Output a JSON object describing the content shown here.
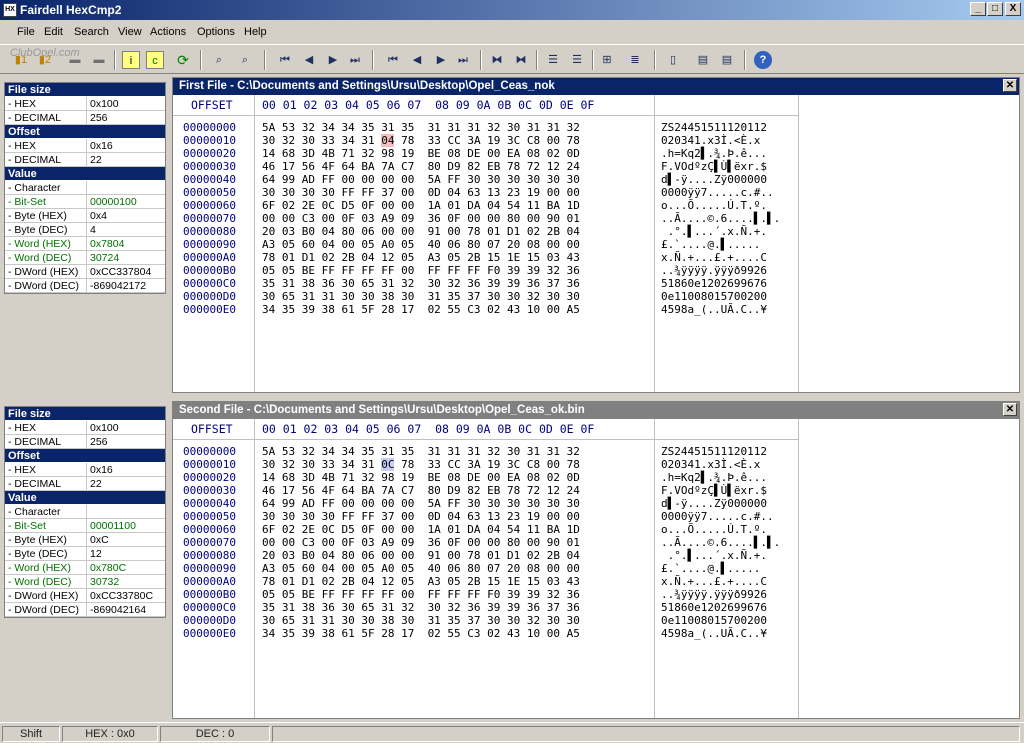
{
  "app": {
    "title": "Fairdell HexCmp2"
  },
  "window_controls": {
    "minimize": "_",
    "maximize": "□",
    "close": "X"
  },
  "menu": [
    "File",
    "Edit",
    "Search",
    "View",
    "Actions",
    "Options",
    "Help"
  ],
  "watermark": "ClubOpel.com",
  "toolbar_icons": [
    "open-file-1-icon",
    "open-file-2-icon",
    "save-icon",
    "print-icon",
    "info-icon",
    "compare-icon",
    "refresh-icon",
    "find-icon",
    "find-next-icon",
    "first-diff-icon",
    "prev-diff-icon",
    "next-diff-icon",
    "last-diff-icon",
    "first-block-icon",
    "prev-block-icon",
    "next-block-icon",
    "last-block-icon",
    "sync-left-icon",
    "sync-right-icon",
    "align-up-icon",
    "align-down-icon",
    "column-icon",
    "lines-icon",
    "new-doc-icon",
    "report-icon",
    "export-icon",
    "help-icon"
  ],
  "colors": {
    "title_active": "#0a246a",
    "title_inactive": "#808080",
    "diff_first": "#f4c0c0",
    "cursor": "#c6cff4",
    "green_value": "#007000",
    "offset_blue": "#000080"
  },
  "info_top": {
    "rows": [
      {
        "type": "hdr",
        "label": "File size"
      },
      {
        "label": "- HEX",
        "value": "0x100"
      },
      {
        "label": "- DECIMAL",
        "value": "256"
      },
      {
        "type": "hdr",
        "label": "Offset"
      },
      {
        "label": "- HEX",
        "value": "0x16"
      },
      {
        "label": "- DECIMAL",
        "value": "22"
      },
      {
        "type": "hdr",
        "label": "Value"
      },
      {
        "label": "- Character",
        "value": ""
      },
      {
        "label": "- Bit-Set",
        "value": "00000100",
        "green": true
      },
      {
        "label": "- Byte (HEX)",
        "value": "0x4"
      },
      {
        "label": "- Byte (DEC)",
        "value": "4"
      },
      {
        "label": "- Word (HEX)",
        "value": "0x7804",
        "green": true
      },
      {
        "label": "- Word (DEC)",
        "value": "30724",
        "green": true
      },
      {
        "label": "- DWord (HEX)",
        "value": "0xCC337804"
      },
      {
        "label": "- DWord (DEC)",
        "value": "-869042172"
      }
    ]
  },
  "info_bottom": {
    "rows": [
      {
        "type": "hdr",
        "label": "File size"
      },
      {
        "label": "- HEX",
        "value": "0x100"
      },
      {
        "label": "- DECIMAL",
        "value": "256"
      },
      {
        "type": "hdr",
        "label": "Offset"
      },
      {
        "label": "- HEX",
        "value": "0x16"
      },
      {
        "label": "- DECIMAL",
        "value": "22"
      },
      {
        "type": "hdr",
        "label": "Value"
      },
      {
        "label": "- Character",
        "value": ""
      },
      {
        "label": "- Bit-Set",
        "value": "00001100",
        "green": true
      },
      {
        "label": "- Byte (HEX)",
        "value": "0xC"
      },
      {
        "label": "- Byte (DEC)",
        "value": "12"
      },
      {
        "label": "- Word (HEX)",
        "value": "0x780C",
        "green": true
      },
      {
        "label": "- Word (DEC)",
        "value": "30732",
        "green": true
      },
      {
        "label": "- DWord (HEX)",
        "value": "0xCC33780C"
      },
      {
        "label": "- DWord (DEC)",
        "value": "-869042164"
      }
    ]
  },
  "panel_first": {
    "title": "First File - C:\\Documents and Settings\\Ursu\\Desktop\\Opel_Ceas_nok",
    "offset_header": "OFFSET",
    "hex_header": "00 01 02 03 04 05 06 07  08 09 0A 0B 0C 0D 0E 0F",
    "offsets": [
      "00000000",
      "00000010",
      "00000020",
      "00000030",
      "00000040",
      "00000050",
      "00000060",
      "00000070",
      "00000080",
      "00000090",
      "000000A0",
      "000000B0",
      "000000C0",
      "000000D0",
      "000000E0"
    ],
    "hex": [
      "5A 53 32 34 34 35 31 35  31 31 31 32 30 31 31 32",
      "30 32 30 33 34 31 04 78  33 CC 3A 19 3C C8 00 78",
      "14 68 3D 4B 71 32 98 19  BE 08 DE 00 EA 08 02 0D",
      "46 17 56 4F 64 BA 7A C7  80 D9 82 EB 78 72 12 24",
      "64 99 AD FF 00 00 00 00  5A FF 30 30 30 30 30 30",
      "30 30 30 30 FF FF 37 00  0D 04 63 13 23 19 00 00",
      "6F 02 2E 0C D5 0F 00 00  1A 01 DA 04 54 11 BA 1D",
      "00 00 C3 00 0F 03 A9 09  36 0F 00 00 80 00 90 01",
      "20 03 B0 04 80 06 00 00  91 00 78 01 D1 02 2B 04",
      "A3 05 60 04 00 05 A0 05  40 06 80 07 20 08 00 00",
      "78 01 D1 02 2B 04 12 05  A3 05 2B 15 1E 15 03 43",
      "05 05 BE FF FF FF FF 00  FF FF FF F0 39 39 32 36",
      "35 31 38 36 30 65 31 32  30 32 36 39 39 36 37 36",
      "30 65 31 31 30 30 38 30  31 35 37 30 30 32 30 30",
      "34 35 39 38 61 5F 28 17  02 55 C3 02 43 10 00 A5"
    ],
    "ascii": [
      "ZS24451511120112",
      "020341.x3Ì.<È.x",
      ".h=Kq2▌.¾.Þ.ê...",
      "F.VOdºzÇ▌Ù▌ëxr.$",
      "d▌-ÿ....Zÿ000000",
      "0000ÿÿ7.....c.#..",
      "o...Õ.....Ú.T.º.",
      "..Ã....©.6....▌.▌.",
      " .°.▌...´.x.Ñ.+.",
      "£.`....@.▌.....",
      "x.Ñ.+...£.+....C",
      "..¾ÿÿÿÿ.ÿÿÿð9926",
      "51860e1202699676",
      "0e11008015700200",
      "4598a_(..UÃ.C..¥"
    ]
  },
  "panel_second": {
    "title": "Second File - C:\\Documents and Settings\\Ursu\\Desktop\\Opel_Ceas_ok.bin",
    "offset_header": "OFFSET",
    "hex_header": "00 01 02 03 04 05 06 07  08 09 0A 0B 0C 0D 0E 0F",
    "offsets": [
      "00000000",
      "00000010",
      "00000020",
      "00000030",
      "00000040",
      "00000050",
      "00000060",
      "00000070",
      "00000080",
      "00000090",
      "000000A0",
      "000000B0",
      "000000C0",
      "000000D0",
      "000000E0"
    ],
    "hex": [
      "5A 53 32 34 34 35 31 35  31 31 31 32 30 31 31 32",
      "30 32 30 33 34 31 0C 78  33 CC 3A 19 3C C8 00 78",
      "14 68 3D 4B 71 32 98 19  BE 08 DE 00 EA 08 02 0D",
      "46 17 56 4F 64 BA 7A C7  80 D9 82 EB 78 72 12 24",
      "64 99 AD FF 00 00 00 00  5A FF 30 30 30 30 30 30",
      "30 30 30 30 FF FF 37 00  0D 04 63 13 23 19 00 00",
      "6F 02 2E 0C D5 0F 00 00  1A 01 DA 04 54 11 BA 1D",
      "00 00 C3 00 0F 03 A9 09  36 0F 00 00 80 00 90 01",
      "20 03 B0 04 80 06 00 00  91 00 78 01 D1 02 2B 04",
      "A3 05 60 04 00 05 A0 05  40 06 80 07 20 08 00 00",
      "78 01 D1 02 2B 04 12 05  A3 05 2B 15 1E 15 03 43",
      "05 05 BE FF FF FF FF 00  FF FF FF F0 39 39 32 36",
      "35 31 38 36 30 65 31 32  30 32 36 39 39 36 37 36",
      "30 65 31 31 30 30 38 30  31 35 37 30 30 32 30 30",
      "34 35 39 38 61 5F 28 17  02 55 C3 02 43 10 00 A5"
    ],
    "ascii": [
      "ZS24451511120112",
      "020341.x3Ì.<È.x",
      ".h=Kq2▌.¾.Þ.ê...",
      "F.VOdºzÇ▌Ù▌ëxr.$",
      "d▌-ÿ....Zÿ000000",
      "0000ÿÿ7.....c.#..",
      "o...Õ.....Ú.T.º.",
      "..Ã....©.6....▌.▌.",
      " .°.▌...´.x.Ñ.+.",
      "£.`....@.▌.....",
      "x.Ñ.+...£.+....C",
      "..¾ÿÿÿÿ.ÿÿÿð9926",
      "51860e1202699676",
      "0e11008015700200",
      "4598a_(..UÃ.C..¥"
    ]
  },
  "status": {
    "shift": "Shift",
    "hex": "HEX : 0x0",
    "dec": "DEC : 0"
  }
}
